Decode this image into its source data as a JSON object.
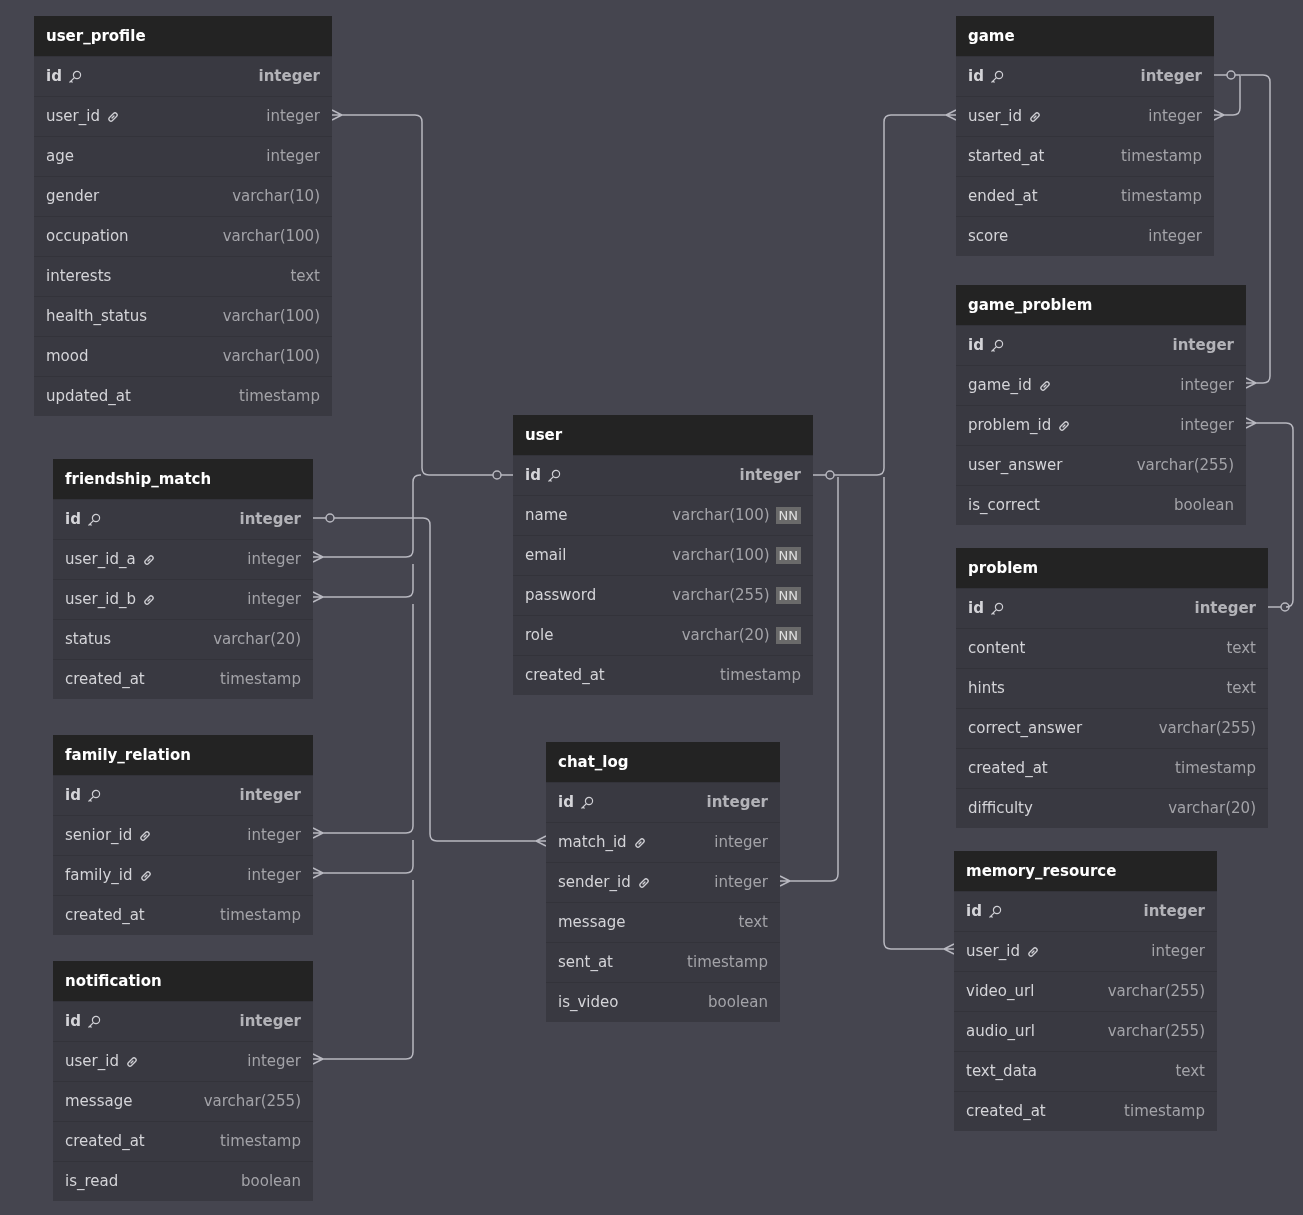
{
  "tables": [
    {
      "name": "user_profile",
      "columns": [
        {
          "name": "id",
          "type": "integer",
          "kind": "primary",
          "not_null": false
        },
        {
          "name": "user_id",
          "type": "integer",
          "kind": "foreign",
          "not_null": false
        },
        {
          "name": "age",
          "type": "integer",
          "kind": "plain",
          "not_null": false
        },
        {
          "name": "gender",
          "type": "varchar(10)",
          "kind": "plain",
          "not_null": false
        },
        {
          "name": "occupation",
          "type": "varchar(100)",
          "kind": "plain",
          "not_null": false
        },
        {
          "name": "interests",
          "type": "text",
          "kind": "plain",
          "not_null": false
        },
        {
          "name": "health_status",
          "type": "varchar(100)",
          "kind": "plain",
          "not_null": false
        },
        {
          "name": "mood",
          "type": "varchar(100)",
          "kind": "plain",
          "not_null": false
        },
        {
          "name": "updated_at",
          "type": "timestamp",
          "kind": "plain",
          "not_null": false
        }
      ]
    },
    {
      "name": "friendship_match",
      "columns": [
        {
          "name": "id",
          "type": "integer",
          "kind": "primary",
          "not_null": false
        },
        {
          "name": "user_id_a",
          "type": "integer",
          "kind": "foreign",
          "not_null": false
        },
        {
          "name": "user_id_b",
          "type": "integer",
          "kind": "foreign",
          "not_null": false
        },
        {
          "name": "status",
          "type": "varchar(20)",
          "kind": "plain",
          "not_null": false
        },
        {
          "name": "created_at",
          "type": "timestamp",
          "kind": "plain",
          "not_null": false
        }
      ]
    },
    {
      "name": "family_relation",
      "columns": [
        {
          "name": "id",
          "type": "integer",
          "kind": "primary",
          "not_null": false
        },
        {
          "name": "senior_id",
          "type": "integer",
          "kind": "foreign",
          "not_null": false
        },
        {
          "name": "family_id",
          "type": "integer",
          "kind": "foreign",
          "not_null": false
        },
        {
          "name": "created_at",
          "type": "timestamp",
          "kind": "plain",
          "not_null": false
        }
      ]
    },
    {
      "name": "notification",
      "columns": [
        {
          "name": "id",
          "type": "integer",
          "kind": "primary",
          "not_null": false
        },
        {
          "name": "user_id",
          "type": "integer",
          "kind": "foreign",
          "not_null": false
        },
        {
          "name": "message",
          "type": "varchar(255)",
          "kind": "plain",
          "not_null": false
        },
        {
          "name": "created_at",
          "type": "timestamp",
          "kind": "plain",
          "not_null": false
        },
        {
          "name": "is_read",
          "type": "boolean",
          "kind": "plain",
          "not_null": false
        }
      ]
    },
    {
      "name": "user",
      "columns": [
        {
          "name": "id",
          "type": "integer",
          "kind": "primary",
          "not_null": false
        },
        {
          "name": "name",
          "type": "varchar(100)",
          "kind": "plain",
          "not_null": true,
          "badge": "NN"
        },
        {
          "name": "email",
          "type": "varchar(100)",
          "kind": "plain",
          "not_null": true,
          "badge": "NN"
        },
        {
          "name": "password",
          "type": "varchar(255)",
          "kind": "plain",
          "not_null": true,
          "badge": "NN"
        },
        {
          "name": "role",
          "type": "varchar(20)",
          "kind": "plain",
          "not_null": true,
          "badge": "NN"
        },
        {
          "name": "created_at",
          "type": "timestamp",
          "kind": "plain",
          "not_null": false
        }
      ]
    },
    {
      "name": "chat_log",
      "columns": [
        {
          "name": "id",
          "type": "integer",
          "kind": "primary",
          "not_null": false
        },
        {
          "name": "match_id",
          "type": "integer",
          "kind": "foreign",
          "not_null": false
        },
        {
          "name": "sender_id",
          "type": "integer",
          "kind": "foreign",
          "not_null": false
        },
        {
          "name": "message",
          "type": "text",
          "kind": "plain",
          "not_null": false
        },
        {
          "name": "sent_at",
          "type": "timestamp",
          "kind": "plain",
          "not_null": false
        },
        {
          "name": "is_video",
          "type": "boolean",
          "kind": "plain",
          "not_null": false
        }
      ]
    },
    {
      "name": "game",
      "columns": [
        {
          "name": "id",
          "type": "integer",
          "kind": "primary",
          "not_null": false
        },
        {
          "name": "user_id",
          "type": "integer",
          "kind": "foreign",
          "not_null": false
        },
        {
          "name": "started_at",
          "type": "timestamp",
          "kind": "plain",
          "not_null": false
        },
        {
          "name": "ended_at",
          "type": "timestamp",
          "kind": "plain",
          "not_null": false
        },
        {
          "name": "score",
          "type": "integer",
          "kind": "plain",
          "not_null": false
        }
      ]
    },
    {
      "name": "game_problem",
      "columns": [
        {
          "name": "id",
          "type": "integer",
          "kind": "primary",
          "not_null": false
        },
        {
          "name": "game_id",
          "type": "integer",
          "kind": "foreign",
          "not_null": false
        },
        {
          "name": "problem_id",
          "type": "integer",
          "kind": "foreign",
          "not_null": false
        },
        {
          "name": "user_answer",
          "type": "varchar(255)",
          "kind": "plain",
          "not_null": false
        },
        {
          "name": "is_correct",
          "type": "boolean",
          "kind": "plain",
          "not_null": false
        }
      ]
    },
    {
      "name": "problem",
      "columns": [
        {
          "name": "id",
          "type": "integer",
          "kind": "primary",
          "not_null": false
        },
        {
          "name": "content",
          "type": "text",
          "kind": "plain",
          "not_null": false
        },
        {
          "name": "hints",
          "type": "text",
          "kind": "plain",
          "not_null": false
        },
        {
          "name": "correct_answer",
          "type": "varchar(255)",
          "kind": "plain",
          "not_null": false
        },
        {
          "name": "created_at",
          "type": "timestamp",
          "kind": "plain",
          "not_null": false
        },
        {
          "name": "difficulty",
          "type": "varchar(20)",
          "kind": "plain",
          "not_null": false
        }
      ]
    },
    {
      "name": "memory_resource",
      "columns": [
        {
          "name": "id",
          "type": "integer",
          "kind": "primary",
          "not_null": false
        },
        {
          "name": "user_id",
          "type": "integer",
          "kind": "foreign",
          "not_null": false
        },
        {
          "name": "video_url",
          "type": "varchar(255)",
          "kind": "plain",
          "not_null": false
        },
        {
          "name": "audio_url",
          "type": "varchar(255)",
          "kind": "plain",
          "not_null": false
        },
        {
          "name": "text_data",
          "type": "text",
          "kind": "plain",
          "not_null": false
        },
        {
          "name": "created_at",
          "type": "timestamp",
          "kind": "plain",
          "not_null": false
        }
      ]
    }
  ]
}
